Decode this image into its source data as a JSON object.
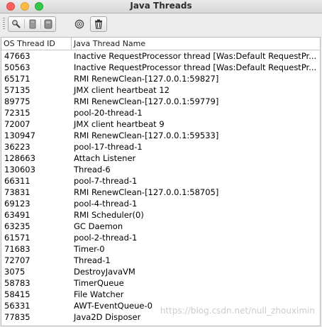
{
  "window": {
    "title": "Java Threads"
  },
  "toolbar": {
    "buttons": [
      {
        "icon": "magnifier-icon"
      },
      {
        "icon": "document-icon"
      },
      {
        "icon": "stack-icon"
      },
      {
        "icon": "target-icon"
      },
      {
        "icon": "trash-icon"
      }
    ]
  },
  "table": {
    "columns": [
      "OS Thread ID",
      "Java Thread Name"
    ],
    "rows": [
      {
        "id": "47663",
        "name": "Inactive RequestProcessor thread [Was:Default RequestPr..."
      },
      {
        "id": "50563",
        "name": "Inactive RequestProcessor thread [Was:Default RequestPr..."
      },
      {
        "id": "65171",
        "name": "RMI RenewClean-[127.0.0.1:59827]"
      },
      {
        "id": "57135",
        "name": "JMX client heartbeat 12"
      },
      {
        "id": "89775",
        "name": "RMI RenewClean-[127.0.0.1:59779]"
      },
      {
        "id": "72315",
        "name": "pool-20-thread-1"
      },
      {
        "id": "72007",
        "name": "JMX client heartbeat 9"
      },
      {
        "id": "130947",
        "name": "RMI RenewClean-[127.0.0.1:59533]"
      },
      {
        "id": "36223",
        "name": "pool-17-thread-1"
      },
      {
        "id": "128663",
        "name": "Attach Listener"
      },
      {
        "id": "130603",
        "name": "Thread-6"
      },
      {
        "id": "66311",
        "name": "pool-7-thread-1"
      },
      {
        "id": "73831",
        "name": "RMI RenewClean-[127.0.0.1:58705]"
      },
      {
        "id": "69123",
        "name": "pool-4-thread-1"
      },
      {
        "id": "63491",
        "name": "RMI Scheduler(0)"
      },
      {
        "id": "63235",
        "name": "GC Daemon"
      },
      {
        "id": "61571",
        "name": "pool-2-thread-1"
      },
      {
        "id": "71683",
        "name": "Timer-0"
      },
      {
        "id": "72707",
        "name": "Thread-1"
      },
      {
        "id": "3075",
        "name": "DestroyJavaVM"
      },
      {
        "id": "58783",
        "name": "TimerQueue"
      },
      {
        "id": "58415",
        "name": "File Watcher"
      },
      {
        "id": "56331",
        "name": "AWT-EventQueue-0"
      },
      {
        "id": "77835",
        "name": "Java2D Disposer"
      }
    ]
  },
  "watermark": "https://blog.csdn.net/null_zhouximin"
}
